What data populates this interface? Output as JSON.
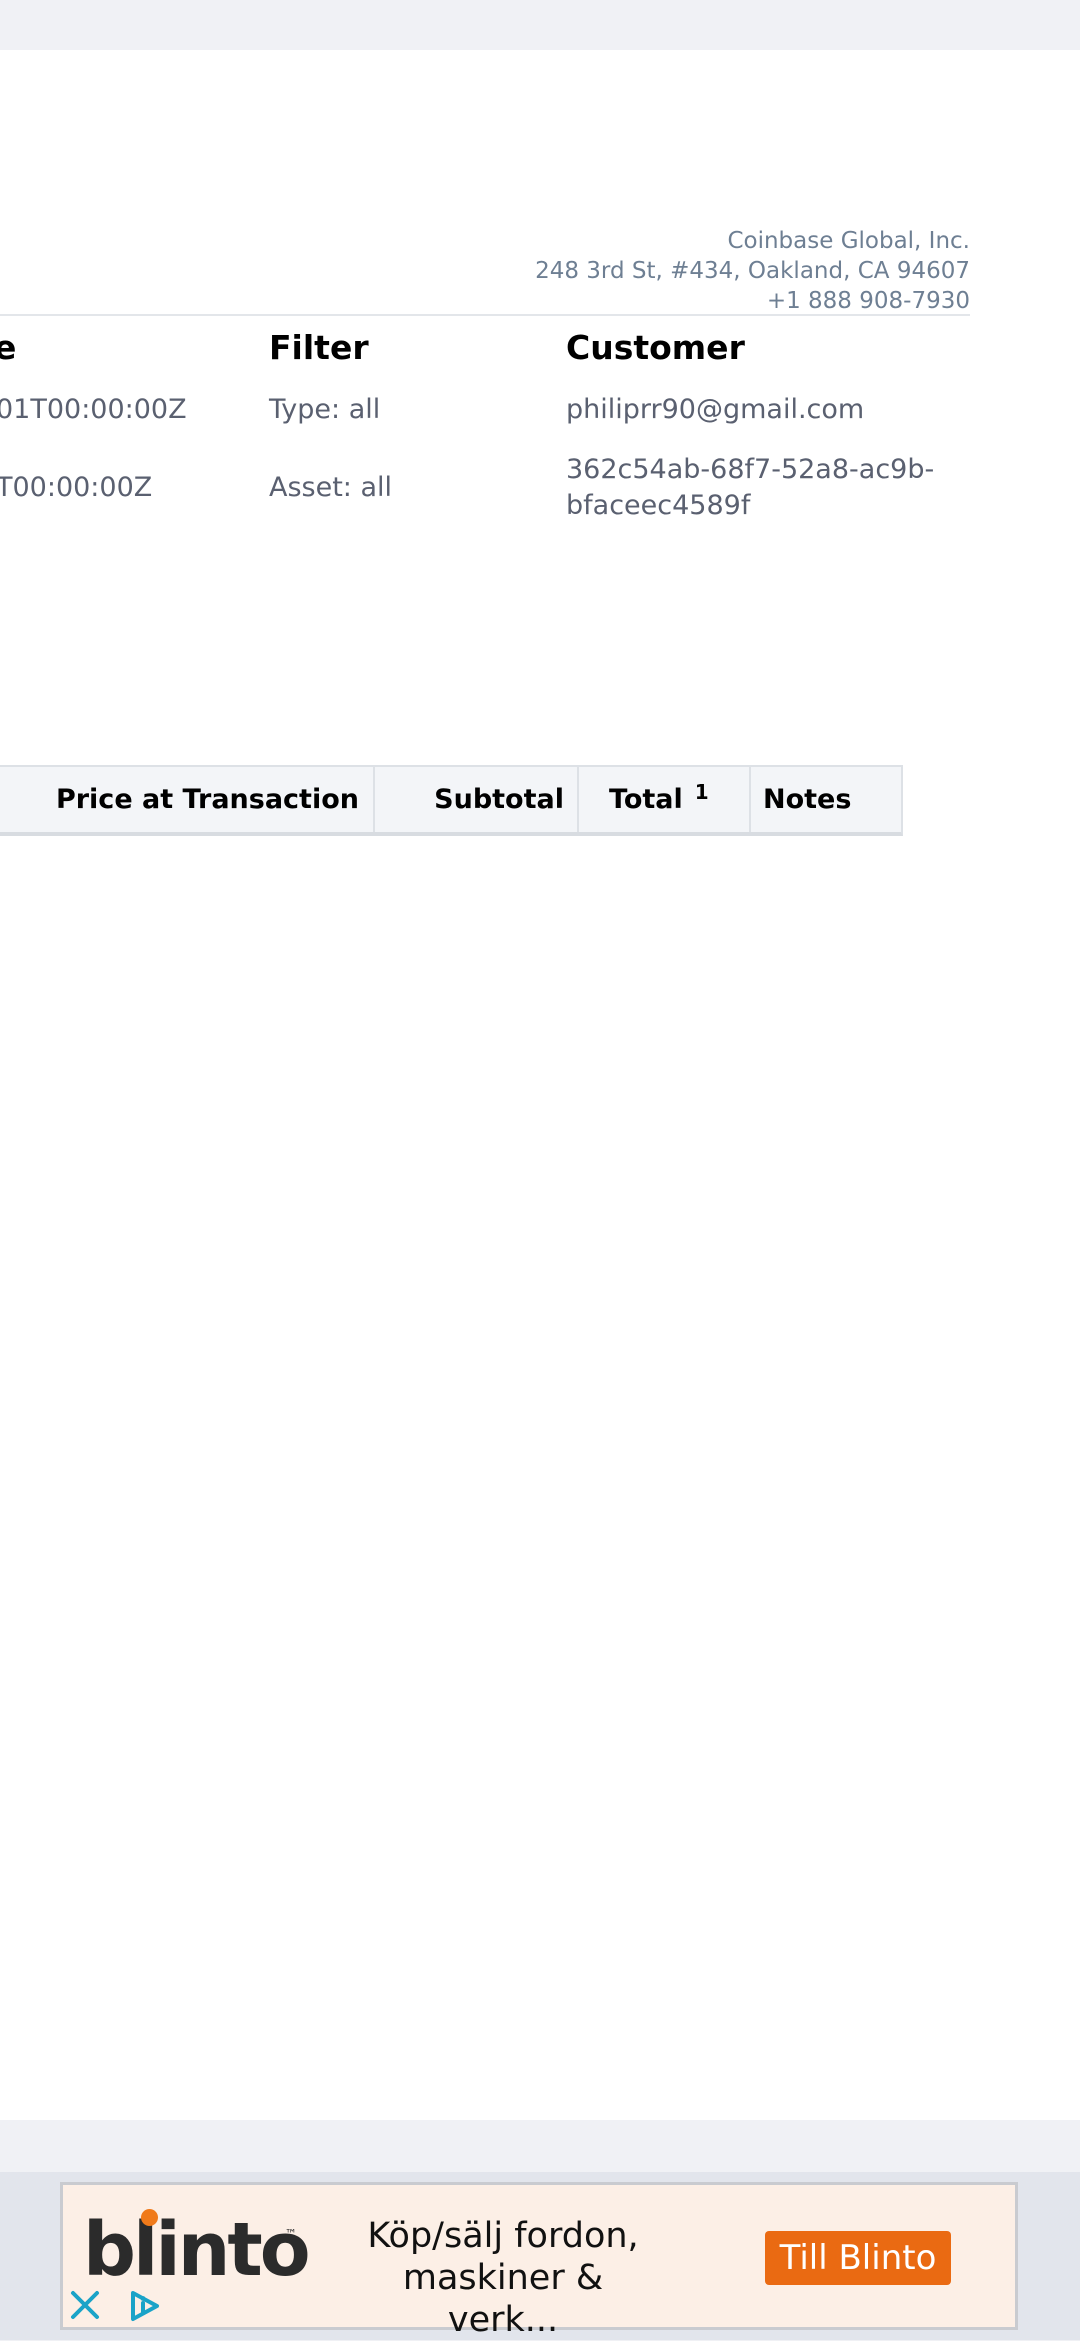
{
  "company": {
    "name": "Coinbase Global, Inc.",
    "address": "248 3rd St, #434, Oakland, CA 94607",
    "phone": "+1 888 908-7930"
  },
  "summary": {
    "date_heading_partial": "e",
    "date_start_partial": "01T00:00:00Z",
    "date_end_partial": "T00:00:00Z",
    "filter_heading": "Filter",
    "filter_type": "Type: all",
    "filter_asset": "Asset: all",
    "customer_heading": "Customer",
    "customer_email": "philiprr90@gmail.com",
    "customer_id_line1": "362c54ab-68f7-52a8-ac9b-",
    "customer_id_line2": "bfaceec4589f"
  },
  "table": {
    "headers": {
      "price": "Price at Transaction",
      "subtotal": "Subtotal",
      "total": "Total",
      "total_footnote": "1",
      "notes": "Notes"
    }
  },
  "ad": {
    "brand": "blinto",
    "tm": "™",
    "text_line1": "Köp/sälj fordon,",
    "text_line2": "maskiner & verk...",
    "cta": "Till Blinto",
    "colors": {
      "brand_orange": "#ea6a12",
      "adchoices_teal": "#1aa3c8"
    }
  }
}
